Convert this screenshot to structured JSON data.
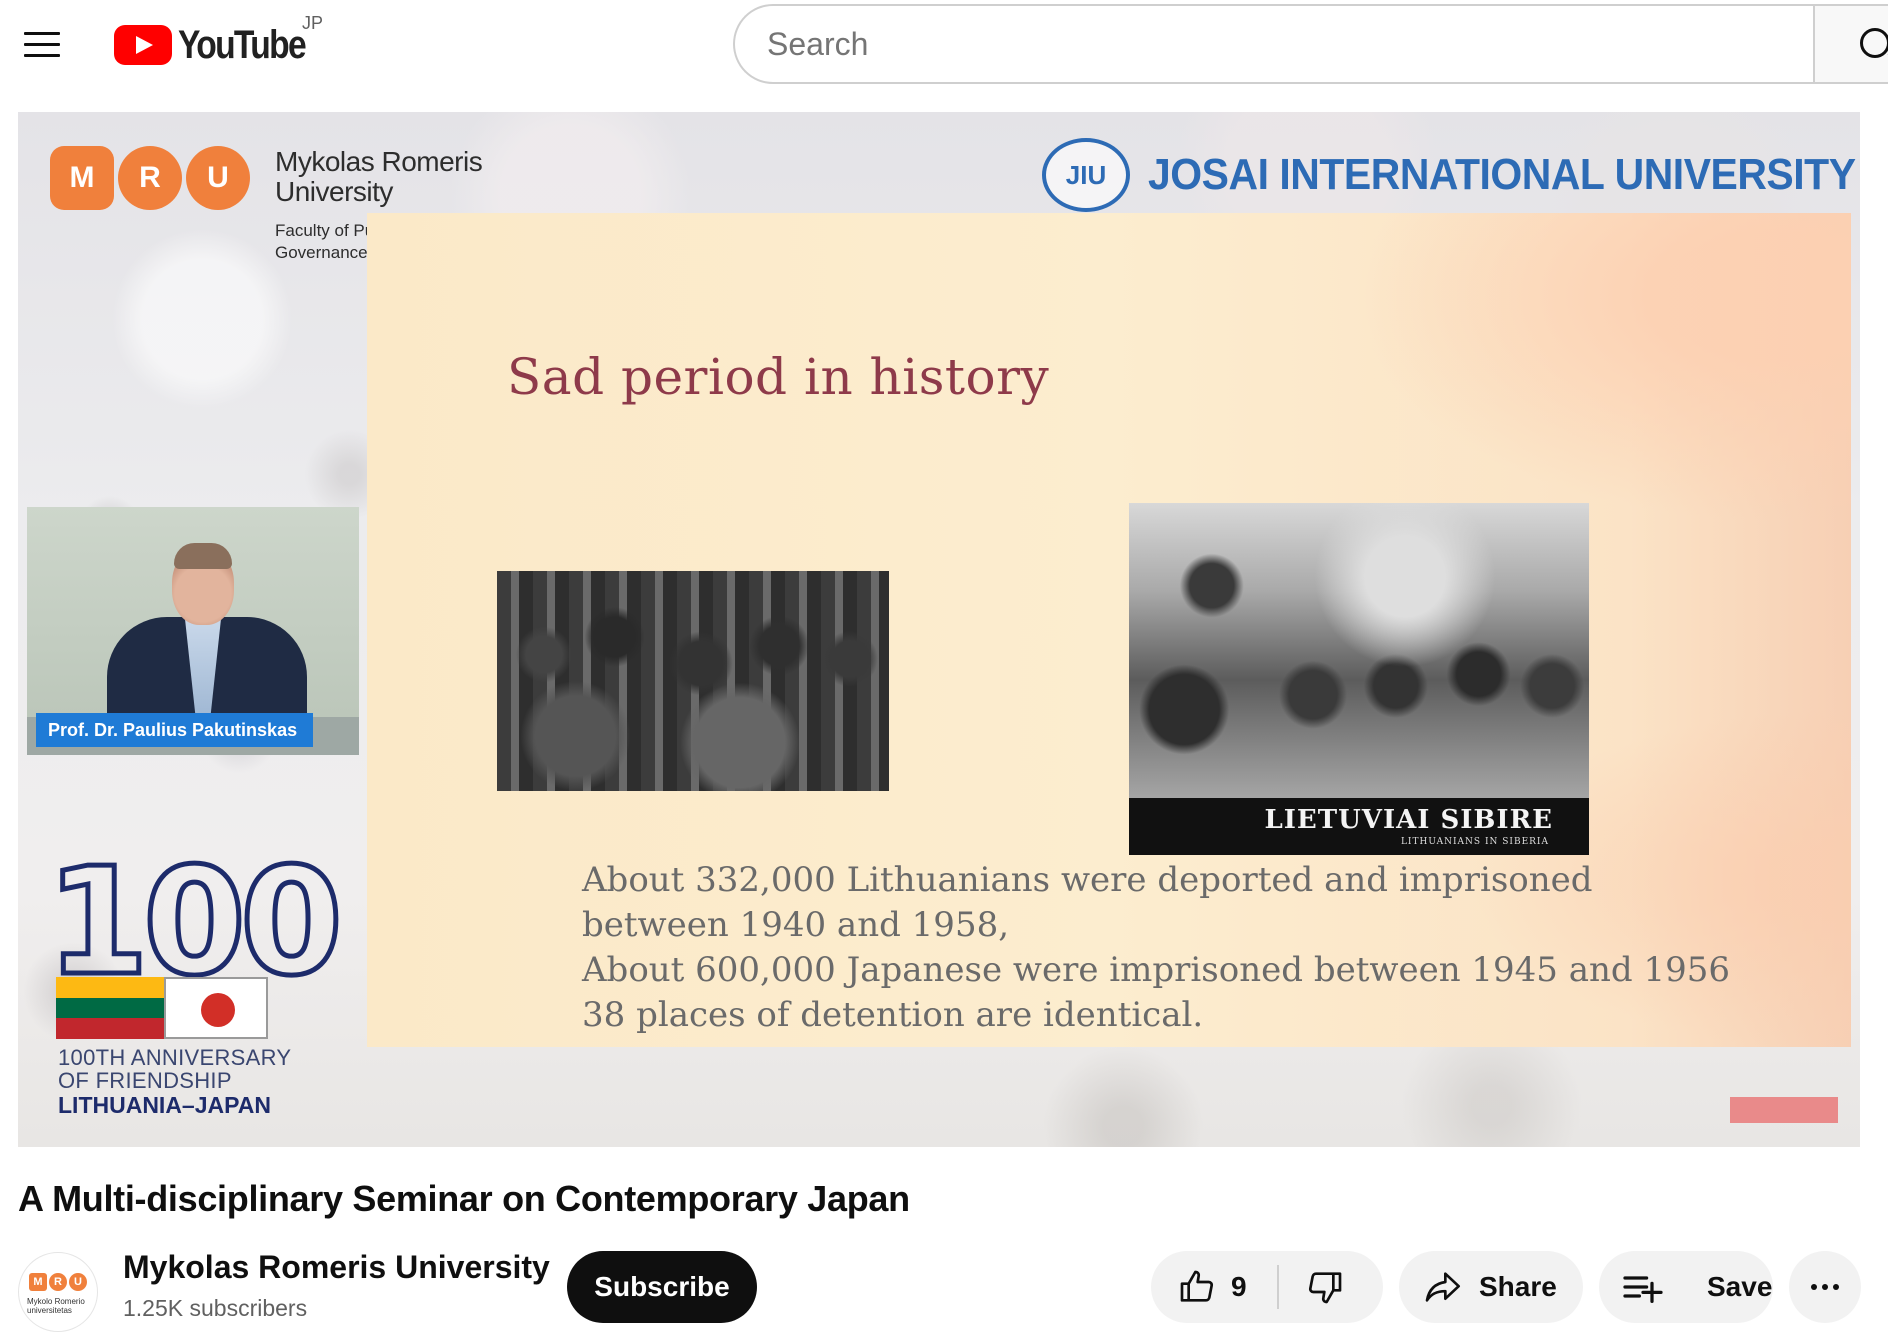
{
  "header": {
    "logo_text": "YouTube",
    "country_code": "JP",
    "search_placeholder": "Search"
  },
  "video_frame": {
    "host_university": {
      "logo_letters": [
        "M",
        "R",
        "U"
      ],
      "name_line1": "Mykolas Romeris",
      "name_line2": "University",
      "faculty_line1": "Faculty of Pu",
      "faculty_line2": "Governance"
    },
    "partner_university": {
      "seal_text": "JIU",
      "name": "JOSAI INTERNATIONAL UNIVERSITY"
    },
    "slide": {
      "title": "Sad period in history",
      "photo_caption_title": "LIETUVIAI SIBIRE",
      "photo_caption_subtitle": "LITHUANIANS IN SIBERIA",
      "body_lines": [
        "About 332,000 Lithuanians were deported and imprisoned",
        "between 1940 and 1958,",
        "About 600,000 Japanese were imprisoned between 1945 and 1956",
        "38 places of detention are identical."
      ]
    },
    "speaker_name": "Prof. Dr. Paulius Pakutinskas",
    "anniversary": {
      "number": "100",
      "line1": "100TH ANNIVERSARY",
      "line2": "OF FRIENDSHIP",
      "line3": "LITHUANIA–JAPAN",
      "lithuania_flag_colors": [
        "#fdb913",
        "#006a44",
        "#c1272d"
      ]
    }
  },
  "video_title": "A Multi-disciplinary Seminar on Contemporary Japan",
  "channel": {
    "name": "Mykolas Romeris University",
    "subscribers": "1.25K subscribers",
    "avatar_letters": [
      "M",
      "R",
      "U"
    ],
    "avatar_caption": "Mykolo Romerio universitetas",
    "subscribe_label": "Subscribe"
  },
  "actions": {
    "like_count": "9",
    "share_label": "Share",
    "save_label": "Save"
  },
  "colors": {
    "youtube_red": "#ff0000",
    "mru_orange": "#f0803c",
    "jiu_blue": "#2d6bb5",
    "slide_title": "#8e3a4a",
    "speaker_tag": "#1f7bd6"
  }
}
